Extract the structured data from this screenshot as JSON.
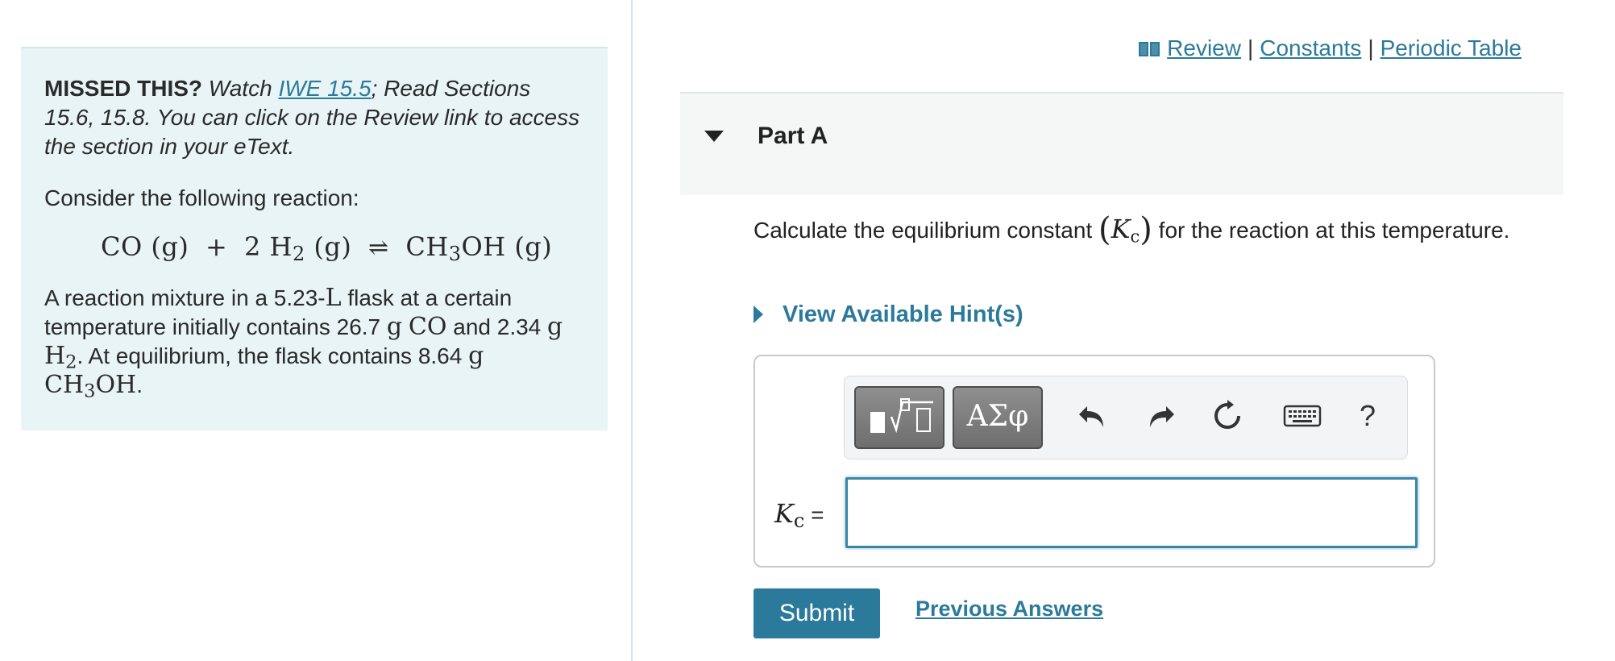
{
  "intro": {
    "missed_label": "MISSED THIS?",
    "watch_text": "Watch",
    "watch_link": "IWE 15.5",
    "read_text": "; Read Sections 15.6, 15.8. You can click on the Review link to access the section in your eText.",
    "consider_text": "Consider the following reaction:",
    "equation": {
      "left_1": "CO (g)",
      "plus": "+",
      "left_2_prefix": "2 H",
      "left_2_sub": "2",
      "left_2_suffix": " (g)",
      "arrow": "⇌",
      "right_prefix": "CH",
      "right_sub": "3",
      "right_suffix": "OH (g)"
    },
    "mixture": {
      "p1": "A reaction mixture in a 5.23-",
      "unit_L": "L",
      "p2": " flask at a certain temperature initially contains 26.7 ",
      "unit_g1": "g",
      "co": "CO",
      "p3": " and 2.34 ",
      "unit_g2": "g",
      "h2_prefix": "H",
      "h2_sub": "2",
      "p4": ". At equilibrium, the flask contains 8.64 ",
      "unit_g3": "g",
      "ch3oh_prefix": "CH",
      "ch3oh_sub": "3",
      "ch3oh_suffix": "OH",
      "p5": "."
    }
  },
  "top_links": {
    "review": "Review",
    "constants": "Constants",
    "periodic_table": "Periodic Table",
    "separator": "|"
  },
  "part": {
    "title": "Part A"
  },
  "question": {
    "before": "Calculate the equilibrium constant ",
    "k_symbol": "K",
    "k_sub": "c",
    "after": " for the reaction at this temperature."
  },
  "hints": {
    "label": "View Available Hint(s)"
  },
  "toolbar": {
    "greek_label": "ΑΣφ",
    "help_label": "?",
    "icons": [
      "templates-icon",
      "undo-icon",
      "redo-icon",
      "reset-icon",
      "keyboard-icon",
      "help-icon"
    ]
  },
  "answer": {
    "label_k": "K",
    "label_sub": "c",
    "label_eq": " =",
    "value": ""
  },
  "actions": {
    "submit": "Submit",
    "previous_answers": "Previous Answers"
  },
  "colors": {
    "link": "#2b7a9b",
    "intro_bg": "#e8f4f6",
    "header_bg": "#f5f7f7",
    "submit_bg": "#2b7a9b"
  }
}
